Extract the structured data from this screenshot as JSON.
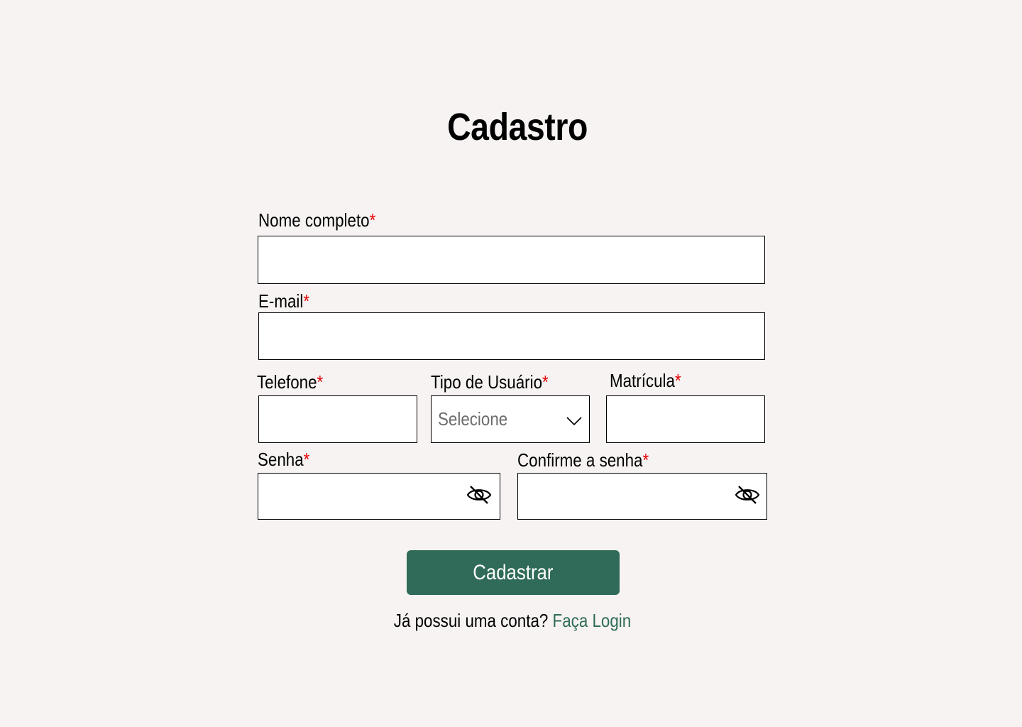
{
  "page": {
    "title": "Cadastro"
  },
  "form": {
    "required_marker": "*",
    "full_name": {
      "label": "Nome completo",
      "value": ""
    },
    "email": {
      "label": "E-mail",
      "value": ""
    },
    "phone": {
      "label": "Telefone",
      "value": ""
    },
    "user_type": {
      "label": "Tipo de Usuário",
      "selected": "Selecione"
    },
    "registration": {
      "label": "Matrícula",
      "value": ""
    },
    "password": {
      "label": "Senha",
      "value": ""
    },
    "confirm_password": {
      "label": "Confirme a senha",
      "value": ""
    },
    "submit_label": "Cadastrar"
  },
  "footer": {
    "prompt": "Já possui uma conta?",
    "link_label": "Faça Login"
  },
  "colors": {
    "background": "#f7f3f2",
    "accent": "#2f6b58",
    "required": "#e00000"
  },
  "icons": {
    "password_toggle": "eye-slash-icon",
    "dropdown": "chevron-down-icon"
  }
}
